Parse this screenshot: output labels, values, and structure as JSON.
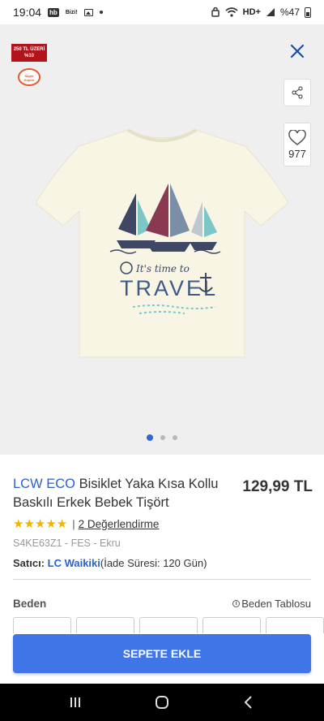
{
  "status_bar": {
    "time": "19:04",
    "hb_badge": "hb",
    "bize_text": "Bizi!",
    "network": "HD+",
    "battery": "%47"
  },
  "hero": {
    "promo_badge": "250 TL ÜZERİ %10",
    "coupon_badge": "Süper Kupon",
    "fav_count": "977",
    "slide_count": 3,
    "active_slide": 1,
    "print_text_script": "It's time to",
    "print_text_main": "TRAVEL"
  },
  "product": {
    "brand": "LCW ECO",
    "name": " Bisiklet Yaka Kısa Kollu Baskılı Erkek Bebek Tişört",
    "price": "129,99 TL",
    "stars": "★★★★★",
    "rating_sep": "|",
    "reviews": "2 Değerlendirme",
    "sku": "S4KE63Z1 - FES - Ekru",
    "seller_label": "Satıcı: ",
    "seller_name": "LC Waikiki",
    "return_info": "(İade Süresi: 120 Gün)"
  },
  "size": {
    "label": "Beden",
    "table_link": "Beden Tablosu",
    "info_icon": "i"
  },
  "actions": {
    "add_to_cart": "SEPETE EKLE"
  },
  "colors": {
    "accent": "#3f75e6",
    "brand_blue": "#2a62c9",
    "star": "#f2b400",
    "promo_red": "#b3131b"
  }
}
